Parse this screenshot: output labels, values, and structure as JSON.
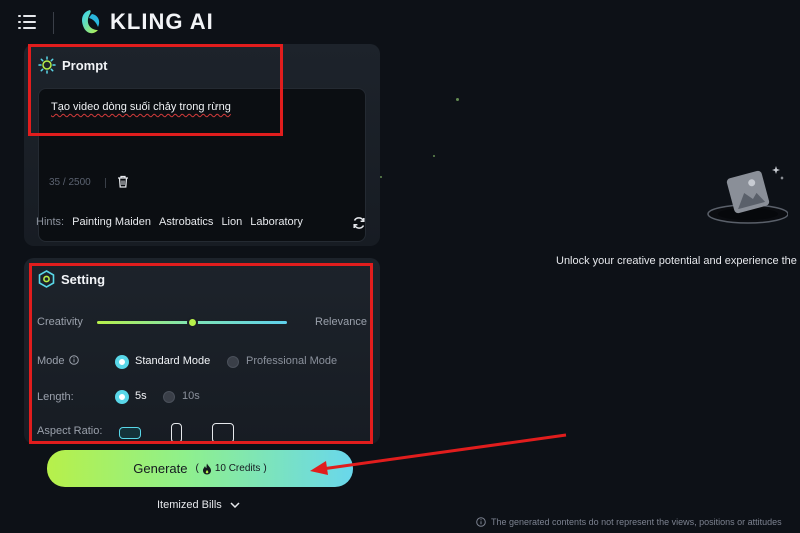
{
  "header": {
    "app_name": "KLING AI",
    "menu_icon": "hamburger-menu-icon",
    "logo_icon": "kling-logo-icon"
  },
  "prompt": {
    "title": "Prompt",
    "icon": "sun-icon",
    "text": "Tạo video dòng suối chảy trong rừng",
    "char_count": "35 / 2500",
    "trash_icon": "trash-icon",
    "hints_label": "Hints:",
    "hints": [
      "Painting Maiden",
      "Astrobatics",
      "Lion",
      "Laboratory"
    ],
    "refresh_icon": "refresh-icon"
  },
  "setting": {
    "title": "Setting",
    "icon": "hexagon-settings-icon",
    "creativity_label": "Creativity",
    "relevance_label": "Relevance",
    "slider_value_percent": 50,
    "mode_label": "Mode",
    "mode_options": [
      "Standard Mode",
      "Professional Mode"
    ],
    "mode_selected": "Standard Mode",
    "length_label": "Length:",
    "length_options": [
      "5s",
      "10s"
    ],
    "length_selected": "5s",
    "aspect_label": "Aspect Ratio:"
  },
  "generate": {
    "label": "Generate",
    "credits": "10 Credits",
    "open_paren": "(",
    "close_paren": ")"
  },
  "footer": {
    "bills_label": "Itemized Bills"
  },
  "right_panel": {
    "unlock_text": "Unlock your creative potential and experience the",
    "disclaimer": "The generated contents do not represent the views, positions or attitudes"
  },
  "colors": {
    "accent_green": "#b7f04a",
    "accent_cyan": "#59d7e8",
    "annotation_red": "#e11d1d",
    "background": "#0d1117"
  }
}
